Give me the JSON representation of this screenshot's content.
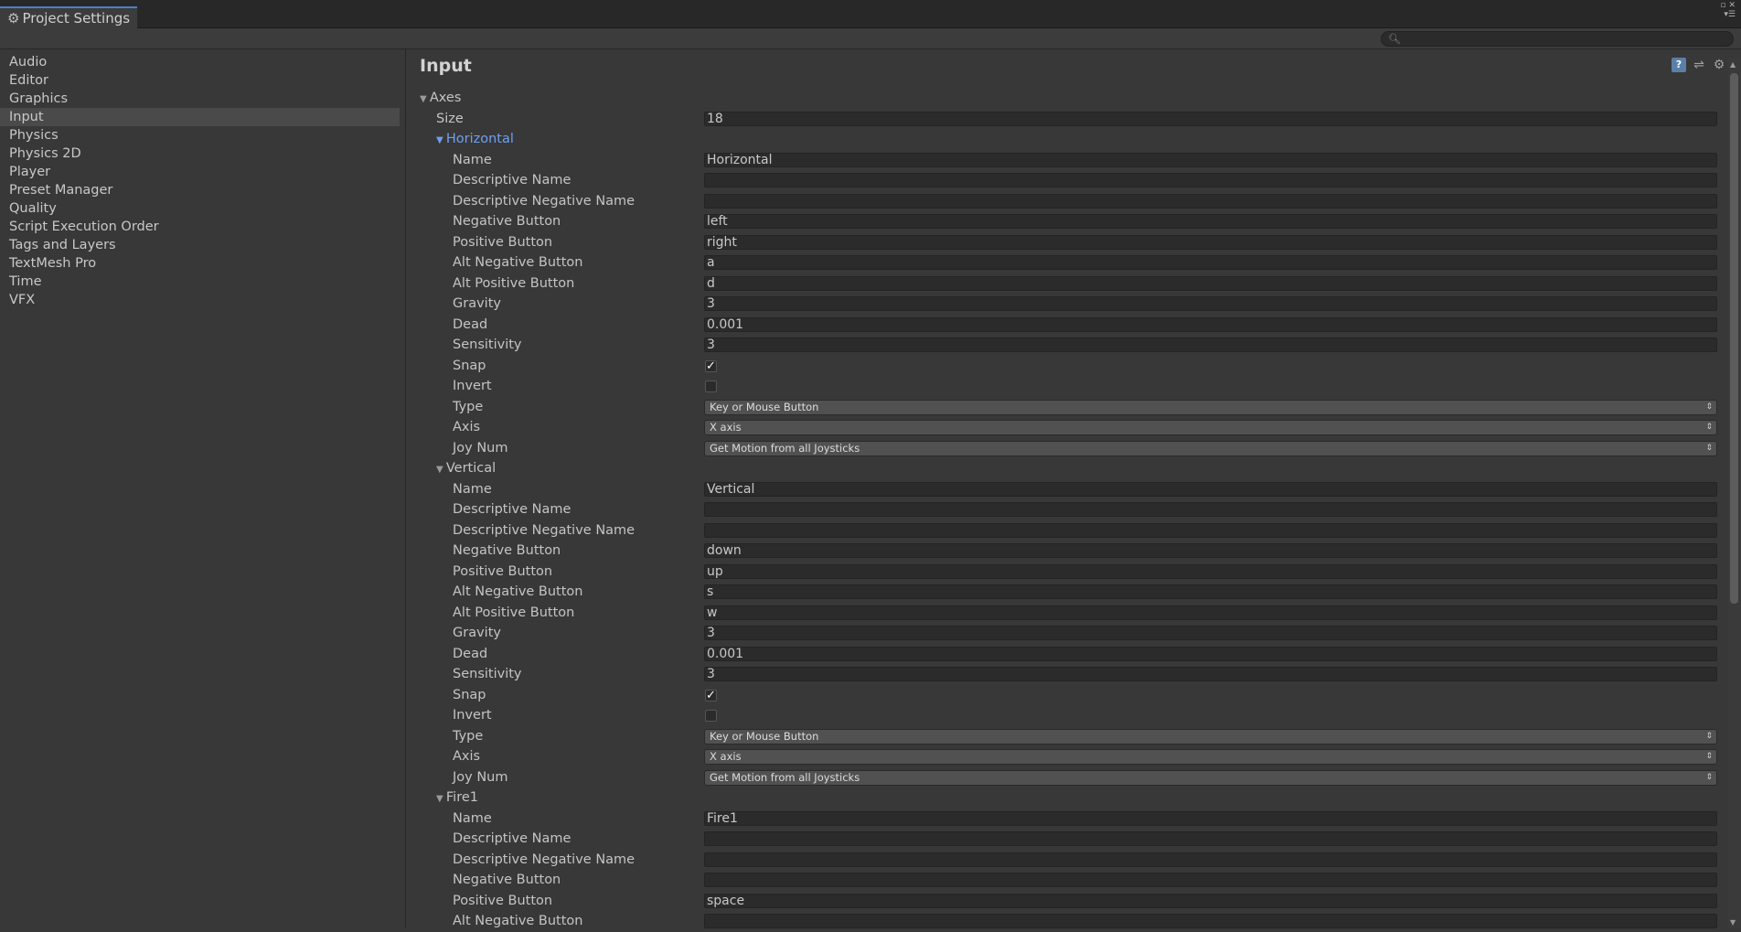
{
  "window": {
    "tab_title": "Project Settings",
    "tab_icon": "gear-icon"
  },
  "search": {
    "placeholder": ""
  },
  "sidebar": {
    "items": [
      {
        "label": "Audio"
      },
      {
        "label": "Editor"
      },
      {
        "label": "Graphics"
      },
      {
        "label": "Input",
        "active": true
      },
      {
        "label": "Physics"
      },
      {
        "label": "Physics 2D"
      },
      {
        "label": "Player"
      },
      {
        "label": "Preset Manager"
      },
      {
        "label": "Quality"
      },
      {
        "label": "Script Execution Order"
      },
      {
        "label": "Tags and Layers"
      },
      {
        "label": "TextMesh Pro"
      },
      {
        "label": "Time"
      },
      {
        "label": "VFX"
      }
    ]
  },
  "main": {
    "title": "Input",
    "header_icons": [
      "help-book-icon",
      "preset-sliders-icon",
      "settings-gear-icon"
    ],
    "axes_label": "Axes",
    "size_label": "Size",
    "size_value": "18",
    "accent_color": "#6f9ff0",
    "axes": [
      {
        "header": "Horizontal",
        "selected": true,
        "fields": [
          {
            "label": "Name",
            "kind": "text",
            "value": "Horizontal"
          },
          {
            "label": "Descriptive Name",
            "kind": "text",
            "value": ""
          },
          {
            "label": "Descriptive Negative Name",
            "kind": "text",
            "value": ""
          },
          {
            "label": "Negative Button",
            "kind": "text",
            "value": "left"
          },
          {
            "label": "Positive Button",
            "kind": "text",
            "value": "right"
          },
          {
            "label": "Alt Negative Button",
            "kind": "text",
            "value": "a"
          },
          {
            "label": "Alt Positive Button",
            "kind": "text",
            "value": "d"
          },
          {
            "label": "Gravity",
            "kind": "text",
            "value": "3"
          },
          {
            "label": "Dead",
            "kind": "text",
            "value": "0.001"
          },
          {
            "label": "Sensitivity",
            "kind": "text",
            "value": "3"
          },
          {
            "label": "Snap",
            "kind": "checkbox",
            "checked": true
          },
          {
            "label": "Invert",
            "kind": "checkbox",
            "checked": false
          },
          {
            "label": "Type",
            "kind": "dropdown",
            "value": "Key or Mouse Button"
          },
          {
            "label": "Axis",
            "kind": "dropdown",
            "value": "X axis"
          },
          {
            "label": "Joy Num",
            "kind": "dropdown",
            "value": "Get Motion from all Joysticks"
          }
        ]
      },
      {
        "header": "Vertical",
        "selected": false,
        "fields": [
          {
            "label": "Name",
            "kind": "text",
            "value": "Vertical"
          },
          {
            "label": "Descriptive Name",
            "kind": "text",
            "value": ""
          },
          {
            "label": "Descriptive Negative Name",
            "kind": "text",
            "value": ""
          },
          {
            "label": "Negative Button",
            "kind": "text",
            "value": "down"
          },
          {
            "label": "Positive Button",
            "kind": "text",
            "value": "up"
          },
          {
            "label": "Alt Negative Button",
            "kind": "text",
            "value": "s"
          },
          {
            "label": "Alt Positive Button",
            "kind": "text",
            "value": "w"
          },
          {
            "label": "Gravity",
            "kind": "text",
            "value": "3"
          },
          {
            "label": "Dead",
            "kind": "text",
            "value": "0.001"
          },
          {
            "label": "Sensitivity",
            "kind": "text",
            "value": "3"
          },
          {
            "label": "Snap",
            "kind": "checkbox",
            "checked": true
          },
          {
            "label": "Invert",
            "kind": "checkbox",
            "checked": false
          },
          {
            "label": "Type",
            "kind": "dropdown",
            "value": "Key or Mouse Button"
          },
          {
            "label": "Axis",
            "kind": "dropdown",
            "value": "X axis"
          },
          {
            "label": "Joy Num",
            "kind": "dropdown",
            "value": "Get Motion from all Joysticks"
          }
        ]
      },
      {
        "header": "Fire1",
        "selected": false,
        "fields": [
          {
            "label": "Name",
            "kind": "text",
            "value": "Fire1"
          },
          {
            "label": "Descriptive Name",
            "kind": "text",
            "value": ""
          },
          {
            "label": "Descriptive Negative Name",
            "kind": "text",
            "value": ""
          },
          {
            "label": "Negative Button",
            "kind": "text",
            "value": ""
          },
          {
            "label": "Positive Button",
            "kind": "text",
            "value": "space"
          },
          {
            "label": "Alt Negative Button",
            "kind": "text",
            "value": ""
          }
        ]
      }
    ]
  }
}
